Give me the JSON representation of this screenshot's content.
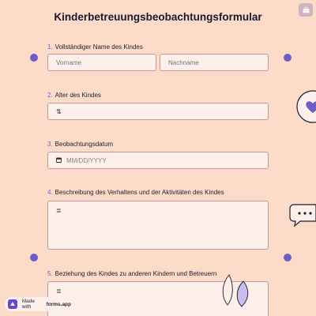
{
  "form": {
    "title": "Kinderbetreuungsbeobachtungsformular"
  },
  "questions": [
    {
      "number": "1.",
      "label": "Vollständiger Name des Kindes"
    },
    {
      "number": "2.",
      "label": "Alter des Kindes"
    },
    {
      "number": "3.",
      "label": "Beobachtungsdatum"
    },
    {
      "number": "4.",
      "label": "Beschreibung des Verhaltens und der Aktivitäten des Kindes"
    },
    {
      "number": "5.",
      "label": "Beziehung des Kindes zu anderen Kindern und Betreuern"
    }
  ],
  "fields": {
    "first_name_placeholder": "Vorname",
    "last_name_placeholder": "Nachname",
    "age_icon": "number-icon",
    "age_icon_glyph": "⇅",
    "date_placeholder": "MM/DD/YYYY",
    "date_icon": "calendar-icon",
    "text_icon": "text-lines-icon",
    "text_icon_glyph": "≣"
  },
  "badge": {
    "prefix": "Made with",
    "brand": "forms.app"
  },
  "colors": {
    "background": "#fcdcc9",
    "accent": "#6b5fc5",
    "field_background": "#fdf0ea",
    "field_border": "#c79a97"
  }
}
